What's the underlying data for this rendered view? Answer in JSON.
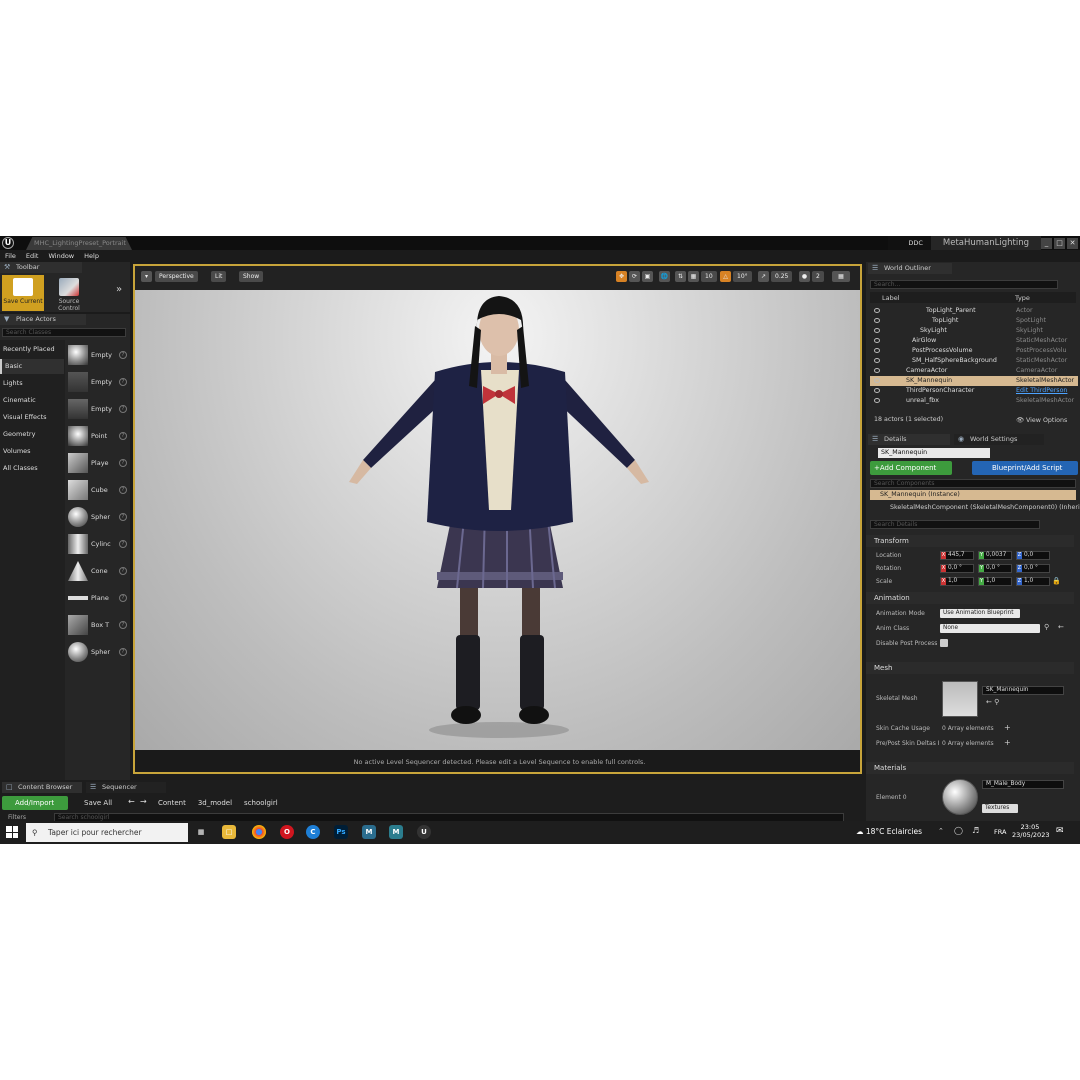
{
  "window": {
    "logo": "U",
    "doc_tab": "MHC_LightingPreset_Portrait",
    "ddc": "DDC",
    "project": "MetaHumanLighting",
    "controls": [
      "_",
      "□",
      "✕"
    ]
  },
  "menu": [
    "File",
    "Edit",
    "Window",
    "Help"
  ],
  "toolbar": {
    "tab": "Toolbar",
    "save_current": "Save Current",
    "source_control": "Source Control"
  },
  "place_actors": {
    "tab": "Place Actors",
    "search_placeholder": "Search Classes",
    "categories": [
      "Recently Placed",
      "Basic",
      "Lights",
      "Cinematic",
      "Visual Effects",
      "Geometry",
      "Volumes",
      "All Classes"
    ],
    "items": [
      "Empty",
      "Empty",
      "Empty",
      "Point",
      "Playe",
      "Cube",
      "Spher",
      "Cylinc",
      "Cone",
      "Plane",
      "Box T",
      "Spher"
    ]
  },
  "viewport": {
    "perspective": "Perspective",
    "lit": "Lit",
    "show": "Show",
    "grid_snap": "10",
    "rot_snap": "10°",
    "scale_snap": "0.25",
    "cam_speed": "2",
    "sequencer_message": "No active Level Sequencer detected. Please edit a Level Sequence to enable full controls."
  },
  "outliner": {
    "tab": "World Outliner",
    "search_placeholder": "Search...",
    "col_label": "Label",
    "col_type": "Type",
    "rows": [
      {
        "name": "TopLight_Parent",
        "type": "Actor"
      },
      {
        "name": "TopLight",
        "type": "SpotLight"
      },
      {
        "name": "SkyLight",
        "type": "SkyLight"
      },
      {
        "name": "AirGlow",
        "type": "StaticMeshActor"
      },
      {
        "name": "PostProcessVolume",
        "type": "PostProcessVolu"
      },
      {
        "name": "SM_HalfSphereBackground",
        "type": "StaticMeshActor"
      },
      {
        "name": "CameraActor",
        "type": "CameraActor"
      },
      {
        "name": "SK_Mannequin",
        "type": "SkeletalMeshActor"
      },
      {
        "name": "ThirdPersonCharacter",
        "type": "Edit ThirdPerson"
      },
      {
        "name": "unreal_fbx",
        "type": "SkeletalMeshActor"
      }
    ],
    "count": "18 actors (1 selected)",
    "view_options": "View Options"
  },
  "details": {
    "tab": "Details",
    "world_settings_tab": "World Settings",
    "name": "SK_Mannequin",
    "add_component": "+Add Component",
    "blueprint": "Blueprint/Add Script",
    "search_components": "Search Components",
    "instance": "SK_Mannequin (Instance)",
    "component": "SkeletalMeshComponent (SkeletalMeshComponent0) (Inherite",
    "search_details": "Search Details",
    "transform": {
      "section": "Transform",
      "location_label": "Location",
      "rotation_label": "Rotation",
      "scale_label": "Scale",
      "location": [
        "445,7",
        "0,0037",
        "0,0"
      ],
      "rotation": [
        "0,0 °",
        "0,0 °",
        "0,0 °"
      ],
      "scale": [
        "1,0",
        "1,0",
        "1,0"
      ]
    },
    "animation": {
      "section": "Animation",
      "mode_label": "Animation Mode",
      "mode_value": "Use Animation Blueprint",
      "class_label": "Anim Class",
      "class_value": "None",
      "disable_label": "Disable Post Process"
    },
    "mesh": {
      "section": "Mesh",
      "skeletal_label": "Skeletal Mesh",
      "skeletal_value": "SK_Mannequin",
      "skin_cache_label": "Skin Cache Usage",
      "skin_cache_value": "0 Array elements",
      "pre_post_label": "Pre/Post Skin Deltas I",
      "pre_post_value": "0 Array elements"
    },
    "materials": {
      "section": "Materials",
      "element_label": "Element 0",
      "element_value": "M_Male_Body",
      "textures": "Textures"
    }
  },
  "content_browser": {
    "tab": "Content Browser",
    "sequencer_tab": "Sequencer",
    "add_import": "Add/Import",
    "save_all": "Save All",
    "path": [
      "Content",
      "3d_model",
      "schoolgirl"
    ],
    "filters": "Filters",
    "search": "Search schoolgirl"
  },
  "taskbar": {
    "search_placeholder": "Taper ici pour rechercher",
    "weather": "18°C  Eclaircies",
    "lang": "FRA",
    "time": "23:05",
    "date": "23/05/2023"
  }
}
